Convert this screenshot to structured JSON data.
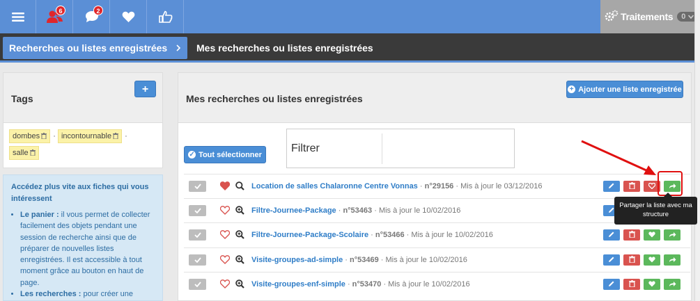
{
  "topbar": {
    "menu_icon": "hamburger-icon",
    "notifications": {
      "icon": "users-icon",
      "count": "6"
    },
    "messages": {
      "icon": "chat-icon",
      "count": "2"
    },
    "favorites_icon": "heart-icon",
    "like_icon": "thumbs-up-icon",
    "traitements": {
      "label": "Traitements",
      "count": "0"
    }
  },
  "breadcrumb": {
    "parent": "Recherches ou listes enregistrées",
    "current": "Mes recherches ou listes enregistrées"
  },
  "tags_panel": {
    "title": "Tags",
    "add_label": "+",
    "tags": [
      "dombes",
      "incontournable",
      "salle"
    ],
    "separator": "·"
  },
  "help": {
    "intro": "Accédez plus vite aux fiches qui vous intéressent",
    "items": [
      {
        "title": "Le panier :",
        "text": " il vous permet de collecter facilement des objets pendant une session de recherche ainsi que de préparer de nouvelles listes enregistrées. Il est accessible à tout moment grâce au bouton en haut de page."
      },
      {
        "title": "Les recherches :",
        "text": " pour créer une nouvelle recherche, utilisez le"
      }
    ]
  },
  "main": {
    "title": "Mes recherches ou listes enregistrées",
    "add_button": "Ajouter une liste enregistrée",
    "select_all": "Tout sélectionner",
    "filter_label": "Filtrer",
    "filter_value": ""
  },
  "rows": [
    {
      "name": "Location de salles Chalaronne Centre Vonnas",
      "id": "n°29156",
      "updated": "Mis à jour le 03/12/2016",
      "favorite": true
    },
    {
      "name": "Filtre-Journee-Package",
      "id": "n°53463",
      "updated": "Mis à jour le 10/02/2016",
      "favorite": false
    },
    {
      "name": "Filtre-Journee-Package-Scolaire",
      "id": "n°53466",
      "updated": "Mis à jour le 10/02/2016",
      "favorite": false
    },
    {
      "name": "Visite-groupes-ad-simple",
      "id": "n°53469",
      "updated": "Mis à jour le 10/02/2016",
      "favorite": false
    },
    {
      "name": "Visite-groupes-enf-simple",
      "id": "n°53470",
      "updated": "Mis à jour le 10/02/2016",
      "favorite": false
    }
  ],
  "tooltip": "Partager la liste avec ma structure",
  "colors": {
    "primary": "#4a8ed6",
    "danger": "#d9534f",
    "success": "#5cb85c",
    "topbar": "#5b8fd6",
    "dark": "#3a3a3a"
  }
}
